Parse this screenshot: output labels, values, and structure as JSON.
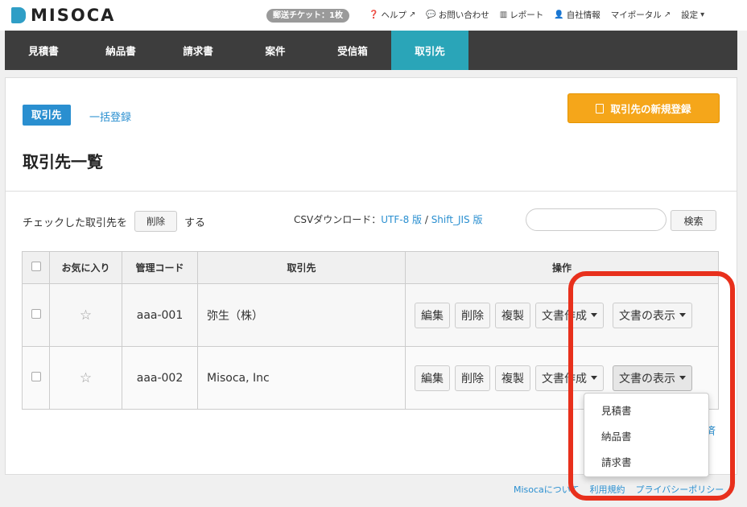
{
  "brand": {
    "name": "MISOCA"
  },
  "topbar": {
    "ticket": "郵送チケット：1枚",
    "links": [
      {
        "icon": "question-icon",
        "label": "ヘルプ",
        "external": true
      },
      {
        "icon": "chat-icon",
        "label": "お問い合わせ",
        "external": false
      },
      {
        "icon": "chart-icon",
        "label": "レポート",
        "external": false
      },
      {
        "icon": "user-icon",
        "label": "自社情報",
        "external": false
      },
      {
        "icon": "",
        "label": "マイポータル",
        "external": true
      },
      {
        "icon": "caret-down-icon",
        "label": "設定",
        "external": false
      }
    ]
  },
  "nav": {
    "items": [
      "見積書",
      "納品書",
      "請求書",
      "案件",
      "受信箱",
      "取引先"
    ],
    "active_index": 5
  },
  "page": {
    "tab_active": "取引先",
    "tab_link": "一括登録",
    "new_button": "取引先の新規登録",
    "title": "取引先一覧",
    "bulk_prefix": "チェックした取引先を",
    "bulk_delete": "削除",
    "bulk_suffix": "する",
    "csv_label": "CSVダウンロード：",
    "csv_utf8": "UTF-8 版",
    "csv_sep": " / ",
    "csv_sjis": "Shift_JIS 版",
    "search_value": "",
    "search_button": "検索"
  },
  "table": {
    "headers": [
      "お気に入り",
      "管理コード",
      "取引先",
      "操作"
    ],
    "rows": [
      {
        "code": "aaa-001",
        "name": "弥生（株）"
      },
      {
        "code": "aaa-002",
        "name": "Misoca, Inc"
      }
    ],
    "actions": {
      "edit": "編集",
      "delete": "削除",
      "duplicate": "複製",
      "create_doc": "文書作成",
      "show_doc": "文書の表示"
    }
  },
  "dropdown": {
    "items": [
      "見積書",
      "納品書",
      "請求書"
    ]
  },
  "partial_text": "済",
  "footer": {
    "links": [
      "Misocaについて",
      "利用規約",
      "プライバシーポリシー"
    ]
  },
  "colors": {
    "accent_blue": "#2a8fd0",
    "nav_active": "#2aa5b8",
    "cta_orange": "#f5a61a",
    "highlight_red": "#e8301c"
  }
}
